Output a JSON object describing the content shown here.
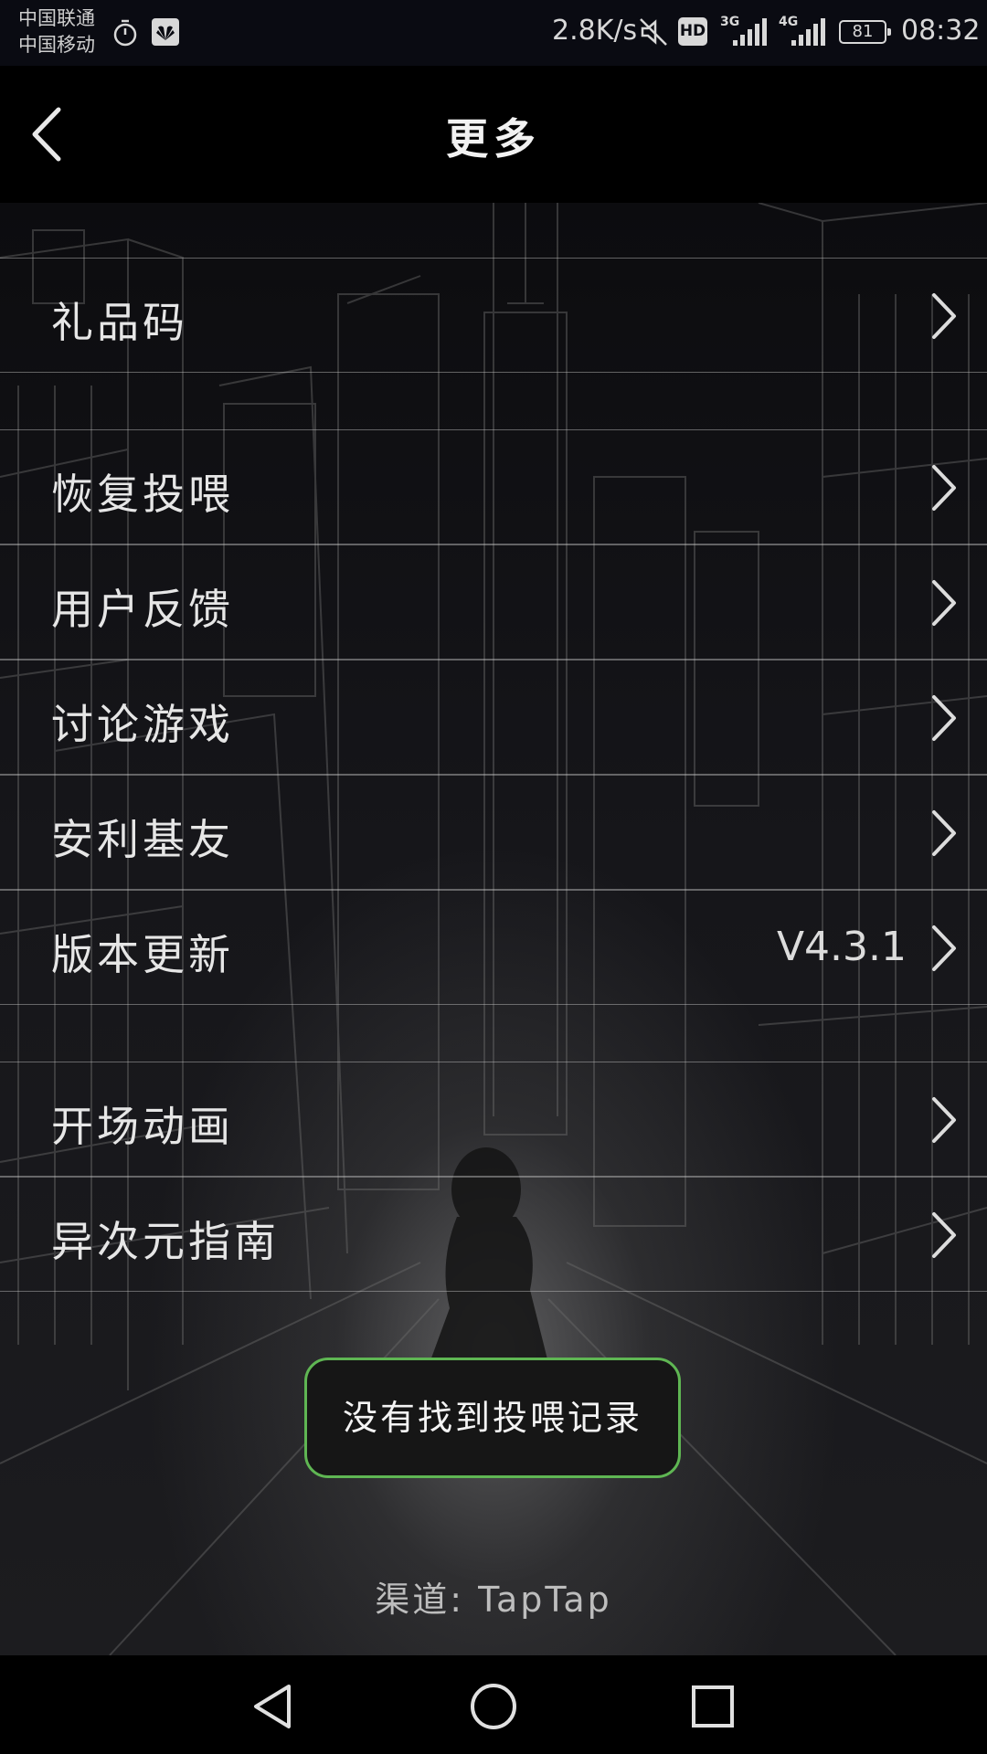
{
  "status_bar": {
    "carrier_1": "中国联通",
    "carrier_2": "中国移动",
    "net_speed": "2.8K/s",
    "hd_label": "HD",
    "net_3g": "3G",
    "net_4g": "4G",
    "battery": "81",
    "time": "08:32",
    "icons": [
      "alarm-icon",
      "huawei-icon",
      "mute-icon",
      "signal-icon",
      "battery-icon"
    ]
  },
  "header": {
    "title": "更多",
    "back_icon": "chevron-left-icon"
  },
  "menu": {
    "items": [
      {
        "label": "礼品码",
        "value": ""
      },
      {
        "label": "恢复投喂",
        "value": ""
      },
      {
        "label": "用户反馈",
        "value": ""
      },
      {
        "label": "讨论游戏",
        "value": ""
      },
      {
        "label": "安利基友",
        "value": ""
      },
      {
        "label": "版本更新",
        "value": "V4.3.1"
      },
      {
        "label": "开场动画",
        "value": ""
      },
      {
        "label": "异次元指南",
        "value": ""
      }
    ]
  },
  "toast": {
    "text": "没有找到投喂记录"
  },
  "footer": {
    "channel": "渠道: TapTap"
  },
  "colors": {
    "toast_border": "#5fb653",
    "background": "#000000",
    "text": "#e6e6e6"
  },
  "nav_bar": {
    "icons": [
      "back-triangle-icon",
      "home-circle-icon",
      "recents-square-icon"
    ]
  }
}
